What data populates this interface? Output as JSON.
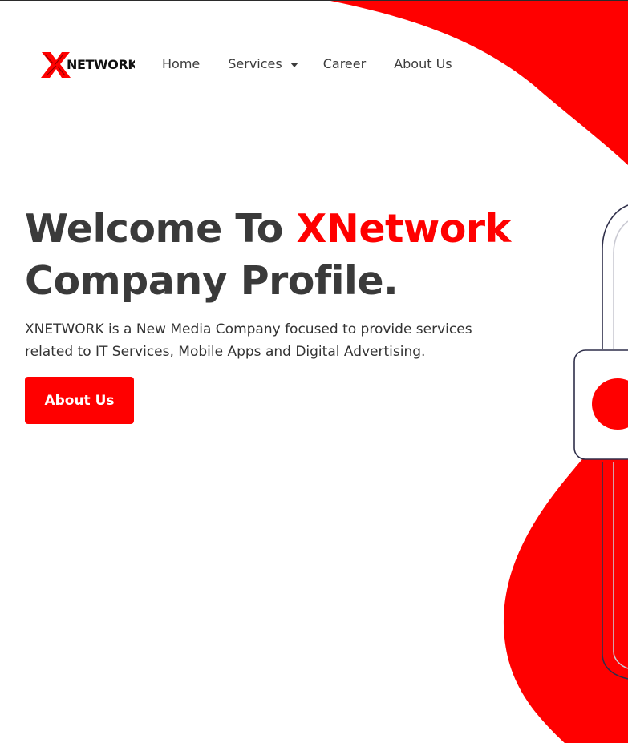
{
  "brand": {
    "logo_text": "NETWORK",
    "logo_mark": "X",
    "accent_color": "#ff0000",
    "text_color": "#3a3a3a"
  },
  "nav": {
    "items": [
      {
        "label": "Home"
      },
      {
        "label": "Services",
        "icon": "caret-down-icon"
      },
      {
        "label": "Career"
      },
      {
        "label": "About Us"
      }
    ]
  },
  "hero": {
    "title_part1": "Welcome To ",
    "title_accent": "XNetwork",
    "title_part2": "Company Profile.",
    "description": "XNETWORK is a New Media Company focused to provide services related to IT Services, Mobile Apps and Digital Advertising.",
    "cta_label": "About Us"
  },
  "illustration": {
    "icon": "padlock-icon"
  }
}
